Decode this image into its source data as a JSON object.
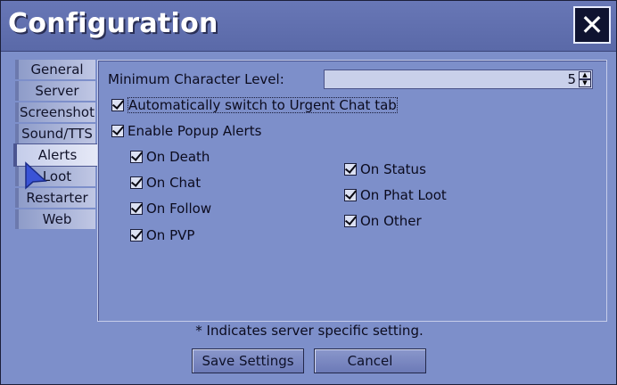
{
  "window": {
    "title": "Configuration",
    "close_icon": "close-icon"
  },
  "tabs": [
    {
      "label": "General"
    },
    {
      "label": "Server"
    },
    {
      "label": "Screenshot"
    },
    {
      "label": "Sound/TTS"
    },
    {
      "label": "Alerts",
      "active": true
    },
    {
      "label": "Loot"
    },
    {
      "label": "Restarter"
    },
    {
      "label": "Web"
    }
  ],
  "alerts": {
    "min_level_label": "Minimum Character Level:",
    "min_level_value": "5",
    "auto_switch_label": "Automatically switch to Urgent Chat tab",
    "auto_switch_checked": true,
    "enable_popup_label": "Enable Popup Alerts",
    "enable_popup_checked": true,
    "left_options": [
      {
        "label": "On Death",
        "checked": true
      },
      {
        "label": "On Chat",
        "checked": true
      },
      {
        "label": "On Follow",
        "checked": true
      },
      {
        "label": "On PVP",
        "checked": true
      }
    ],
    "right_options": [
      {
        "label": "On Status",
        "checked": true
      },
      {
        "label": "On Phat Loot",
        "checked": true
      },
      {
        "label": "On Other",
        "checked": true
      }
    ]
  },
  "footer": {
    "note": "* Indicates server specific setting.",
    "save_label": "Save Settings",
    "cancel_label": "Cancel"
  },
  "colors": {
    "background": "#7d8fca",
    "titlebar": "#5a69a8",
    "field": "#c9d0ea"
  }
}
